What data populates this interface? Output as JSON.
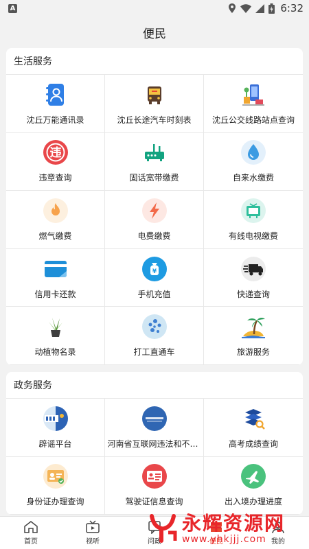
{
  "status_bar": {
    "time": "6:32"
  },
  "header": {
    "title": "便民"
  },
  "sections": [
    {
      "title": "生活服务",
      "items": [
        {
          "label": "沈丘万能通讯录",
          "icon": "contact-book-icon"
        },
        {
          "label": "沈丘长途汽车时刻表",
          "icon": "bus-icon"
        },
        {
          "label": "沈丘公交线路站点查询",
          "icon": "bus-stop-icon"
        },
        {
          "label": "违章查询",
          "icon": "traffic-violation-icon"
        },
        {
          "label": "固话宽带缴费",
          "icon": "router-icon"
        },
        {
          "label": "自来水缴费",
          "icon": "water-drop-icon"
        },
        {
          "label": "燃气缴费",
          "icon": "flame-icon"
        },
        {
          "label": "电费缴费",
          "icon": "lightning-icon"
        },
        {
          "label": "有线电视缴费",
          "icon": "tv-icon"
        },
        {
          "label": "信用卡还款",
          "icon": "credit-card-icon"
        },
        {
          "label": "手机充值",
          "icon": "money-bag-icon"
        },
        {
          "label": "快递查询",
          "icon": "delivery-truck-icon"
        },
        {
          "label": "动植物名录",
          "icon": "plant-icon"
        },
        {
          "label": "打工直通车",
          "icon": "dots-icon"
        },
        {
          "label": "旅游服务",
          "icon": "palm-tree-icon"
        }
      ]
    },
    {
      "title": "政务服务",
      "items": [
        {
          "label": "辟谣平台",
          "icon": "rumor-platform-icon"
        },
        {
          "label": "河南省互联网违法和不良…",
          "icon": "report-center-icon"
        },
        {
          "label": "高考成绩查询",
          "icon": "books-search-icon"
        },
        {
          "label": "身份证办理查询",
          "icon": "id-card-icon"
        },
        {
          "label": "驾驶证信息查询",
          "icon": "driver-license-icon"
        },
        {
          "label": "出入境办理进度",
          "icon": "airplane-icon"
        }
      ]
    }
  ],
  "bottom_nav": [
    {
      "label": "首页",
      "icon": "home-icon"
    },
    {
      "label": "视听",
      "icon": "tv-play-icon"
    },
    {
      "label": "问政",
      "icon": "chat-icon"
    },
    {
      "label": "便民",
      "icon": "services-icon"
    },
    {
      "label": "我的",
      "icon": "user-icon"
    }
  ],
  "watermark": {
    "brand": "永辉资源网",
    "url": "www.yhkjjj.com"
  },
  "colors": {
    "accent": "#e8462f",
    "watermark": "#e8262a"
  }
}
